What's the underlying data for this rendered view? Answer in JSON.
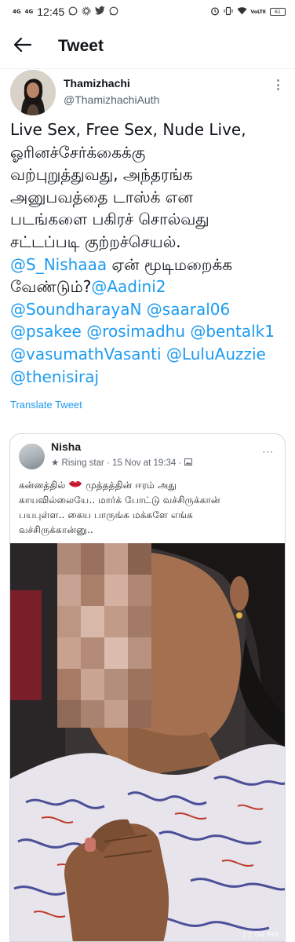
{
  "status_bar": {
    "network_1": "4G",
    "network_2": "4G",
    "time": "12:45",
    "volte": "VoLTE",
    "battery": "61",
    "icons": [
      "whatsapp-icon",
      "settings-icon",
      "twitter-icon",
      "whatsapp-icon",
      "alarm-icon",
      "vibrate-icon",
      "wifi-icon",
      "battery-icon"
    ]
  },
  "header": {
    "title": "Tweet",
    "back_icon": "arrow-left-icon"
  },
  "tweet": {
    "author_name": "Thamizhachi",
    "author_handle": "@ThamizhachiAuth",
    "more_icon": "more-vertical-icon",
    "body_lines": [
      [
        {
          "text": "Live Sex, Free Sex, Nude Live,",
          "mention": false
        }
      ],
      [
        {
          "text": "ஓரினச்சேர்க்கைக்கு",
          "mention": false
        }
      ],
      [
        {
          "text": "வற்புறுத்துவது, அந்தரங்க",
          "mention": false
        }
      ],
      [
        {
          "text": "அனுபவத்தை டாஸ்க் என",
          "mention": false
        }
      ],
      [
        {
          "text": "படங்களை பகிரச் சொல்வது",
          "mention": false
        }
      ],
      [
        {
          "text": "சட்டப்படி குற்றச்செயல்.",
          "mention": false
        }
      ],
      [
        {
          "text": "@S_Nishaaa",
          "mention": true
        },
        {
          "text": " ஏன் மூடிமறைக்க",
          "mention": false
        }
      ],
      [
        {
          "text": "வேண்டும்?",
          "mention": false
        },
        {
          "text": "@Aadini2",
          "mention": true
        }
      ],
      [
        {
          "text": "@SoundharayaN @saaral06",
          "mention": true
        }
      ],
      [
        {
          "text": "@psakee @rosimadhu @bentalk1",
          "mention": true
        }
      ],
      [
        {
          "text": "@vasumathVasanti @LuluAuzzie",
          "mention": true
        }
      ],
      [
        {
          "text": "@thenisiraj",
          "mention": true
        }
      ]
    ],
    "translate_label": "Translate Tweet"
  },
  "embedded_post": {
    "author": "Nisha",
    "badge": "Rising star",
    "date": "15 Nov at 19:34",
    "separator": "·",
    "privacy_icon": "photo-icon",
    "more_label": "···",
    "text_lines": [
      {
        "before": "கன்னத்தில் ",
        "after": " முத்தத்தின் ஈரம் அது"
      },
      {
        "before": "காயவில்லையே.. மார்க் போட்டு வச்சிருக்கான்",
        "after": ""
      },
      {
        "before": "பயபுள்ள.. கைய பாருங்க மக்களே எங்க",
        "after": ""
      },
      {
        "before": "வச்சிருக்கான்னு..",
        "after": ""
      }
    ],
    "emoji": "kiss-lips-icon",
    "photo_description": "pixelated-face-photo",
    "photo_timestamp": "12:04 PM"
  },
  "colors": {
    "link": "#1d9bf0",
    "text": "#0f1419",
    "secondary": "#536471"
  }
}
